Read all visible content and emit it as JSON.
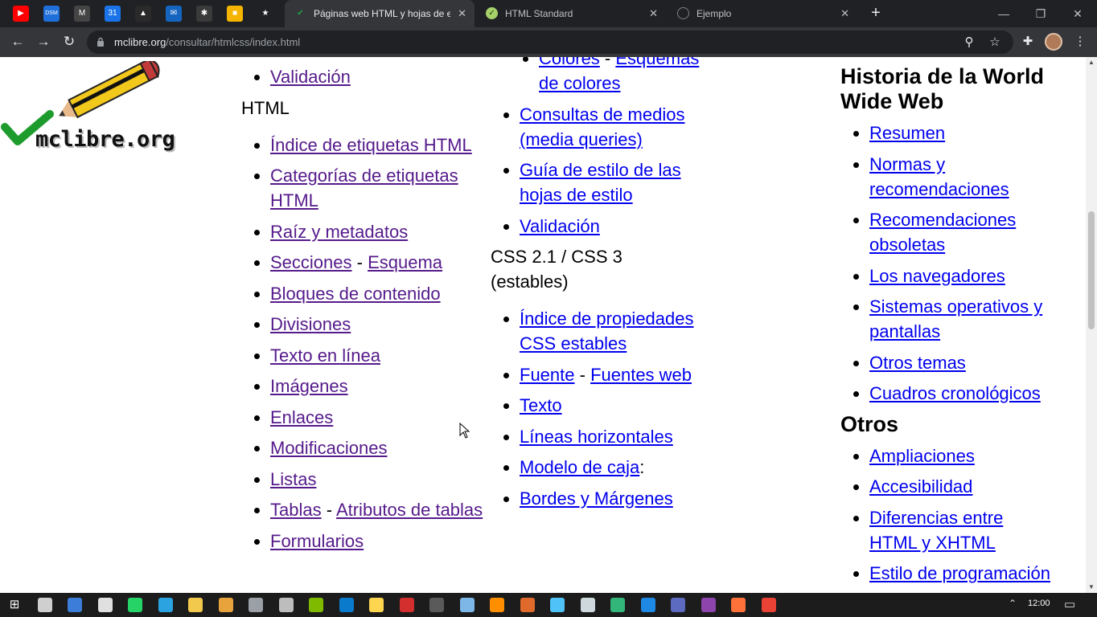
{
  "browser": {
    "pinned_tabs": [
      {
        "name": "youtube",
        "color": "#ff0000",
        "glyph": "▶"
      },
      {
        "name": "dsm",
        "color": "#1e6fd9",
        "glyph": "DSM"
      },
      {
        "name": "gmail",
        "color": "#444444",
        "glyph": "M"
      },
      {
        "name": "calendar",
        "color": "#1a73e8",
        "glyph": "31"
      },
      {
        "name": "drive",
        "color": "#2a2a2a",
        "glyph": "▲"
      },
      {
        "name": "mail",
        "color": "#1565c0",
        "glyph": "✉"
      },
      {
        "name": "extension",
        "color": "#3a3a3a",
        "glyph": "✱"
      },
      {
        "name": "keep",
        "color": "#f4b400",
        "glyph": "■"
      },
      {
        "name": "bookmark",
        "color": "#202124",
        "glyph": "★"
      }
    ],
    "tabs": [
      {
        "title": "Páginas web HTML y hojas de es",
        "active": true
      },
      {
        "title": "HTML Standard",
        "active": false
      },
      {
        "title": "Ejemplo",
        "active": false
      }
    ],
    "url_domain": "mclibre.org",
    "url_path": "/consultar/htmlcss/index.html"
  },
  "logo": {
    "text": "mclibre.org"
  },
  "col1": {
    "top_items": [
      {
        "label": "Validación"
      }
    ],
    "section_label": "HTML",
    "items": [
      {
        "a": "Índice de etiquetas HTML"
      },
      {
        "a": "Categorías de etiquetas HTML"
      },
      {
        "a": "Raíz y metadatos"
      },
      {
        "a": "Secciones",
        "b": "Esquema"
      },
      {
        "a": "Bloques de contenido"
      },
      {
        "a": "Divisiones"
      },
      {
        "a": "Texto en línea"
      },
      {
        "a": "Imágenes"
      },
      {
        "a": "Enlaces"
      },
      {
        "a": "Modificaciones"
      },
      {
        "a": "Listas"
      },
      {
        "a": "Tablas",
        "b": "Atributos de tablas"
      },
      {
        "a": "Formularios"
      }
    ]
  },
  "col2": {
    "sub_items": [
      {
        "a": "Colores",
        "b": "Esquemas de colores"
      }
    ],
    "items": [
      {
        "a": "Consultas de medios (media queries)"
      },
      {
        "a": "Guía de estilo de las hojas de estilo"
      },
      {
        "a": "Validación"
      }
    ],
    "section_label": "CSS 2.1 / CSS 3 (estables)",
    "items2": [
      {
        "a": "Índice de propiedades CSS estables"
      },
      {
        "a": "Fuente",
        "b": "Fuentes web"
      },
      {
        "a": "Texto"
      },
      {
        "a": "Líneas horizontales"
      },
      {
        "a": "Modelo de caja",
        "suffix": ":"
      },
      {
        "a": "Bordes y Márgenes"
      }
    ]
  },
  "col3": {
    "heading1": "Historia de la World Wide Web",
    "items1": [
      {
        "a": "Resumen"
      },
      {
        "a": "Normas y recomendaciones"
      },
      {
        "a": "Recomendaciones obsoletas"
      },
      {
        "a": "Los navegadores"
      },
      {
        "a": "Sistemas operativos y pantallas"
      },
      {
        "a": "Otros temas"
      },
      {
        "a": "Cuadros cronológicos"
      }
    ],
    "heading2": "Otros",
    "items2": [
      {
        "a": "Ampliaciones"
      },
      {
        "a": "Accesibilidad"
      },
      {
        "a": "Diferencias entre HTML y XHTML"
      },
      {
        "a": "Estilo de programación"
      }
    ]
  },
  "taskbar": {
    "clock": "12:00",
    "apps": [
      "start",
      "task-view",
      "keyboard",
      "app-box",
      "whatsapp",
      "telegram",
      "file-explorer",
      "stats",
      "terminal",
      "vm",
      "notepad",
      "vscode",
      "editor",
      "filezilla",
      "obs",
      "3d",
      "vlc",
      "archiver",
      "media",
      "network",
      "edge",
      "ie",
      "chrome-dev",
      "app-purple",
      "firefox",
      "chrome"
    ]
  },
  "colors": {
    "link": "#0000ee",
    "visited": "#551a8b",
    "titlebar": "#202124",
    "toolbar": "#35363a"
  }
}
